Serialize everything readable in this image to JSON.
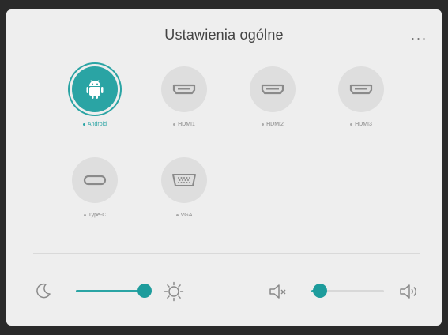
{
  "window": {
    "title": "Ustawienia ogólne",
    "more_label": "..."
  },
  "sources": [
    {
      "label": "Android",
      "icon": "android-icon",
      "active": true
    },
    {
      "label": "HDMI1",
      "icon": "hdmi-port-icon",
      "active": false
    },
    {
      "label": "HDMI2",
      "icon": "hdmi-port-icon",
      "active": false
    },
    {
      "label": "HDMI3",
      "icon": "hdmi-port-icon",
      "active": false
    },
    {
      "label": "Type-C",
      "icon": "usb-c-port-icon",
      "active": false
    },
    {
      "label": "VGA",
      "icon": "vga-port-icon",
      "active": false
    }
  ],
  "brightness": {
    "value": 1.0,
    "min_icon": "moon-icon",
    "max_icon": "sun-icon"
  },
  "volume": {
    "value": 0.12,
    "min_icon": "volume-mute-icon",
    "max_icon": "volume-high-icon"
  },
  "colors": {
    "accent": "#2aa4a4",
    "panel": "#eeeeee",
    "circle": "#dedede"
  }
}
